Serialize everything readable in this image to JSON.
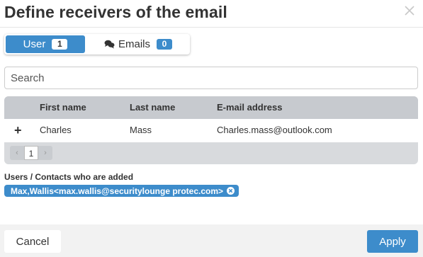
{
  "dialog": {
    "title": "Define receivers of the email",
    "close_icon": "close-icon"
  },
  "tabs": [
    {
      "label": "User",
      "count": "1",
      "active": true
    },
    {
      "label": "Emails",
      "count": "0",
      "active": false,
      "icon": "comments-icon"
    }
  ],
  "search": {
    "placeholder": "Search",
    "value": ""
  },
  "grid": {
    "columns": [
      "First name",
      "Last name",
      "E-mail address"
    ],
    "rows": [
      {
        "action": "+",
        "first_name": "Charles",
        "last_name": "Mass",
        "email": "Charles.mass@outlook.com"
      }
    ],
    "pager": {
      "prev": "‹",
      "page": "1",
      "next": "›"
    }
  },
  "added": {
    "label": "Users / Contacts who are added",
    "chips": [
      {
        "text": "Max,Wallis<max.wallis@securitylounge protec.com>",
        "remove_icon": "remove-circle-icon"
      }
    ]
  },
  "footer": {
    "cancel_label": "Cancel",
    "apply_label": "Apply"
  },
  "colors": {
    "accent": "#3d8ccb",
    "grid_header": "#c7cacf",
    "footer_bg": "#f2f2f2"
  }
}
